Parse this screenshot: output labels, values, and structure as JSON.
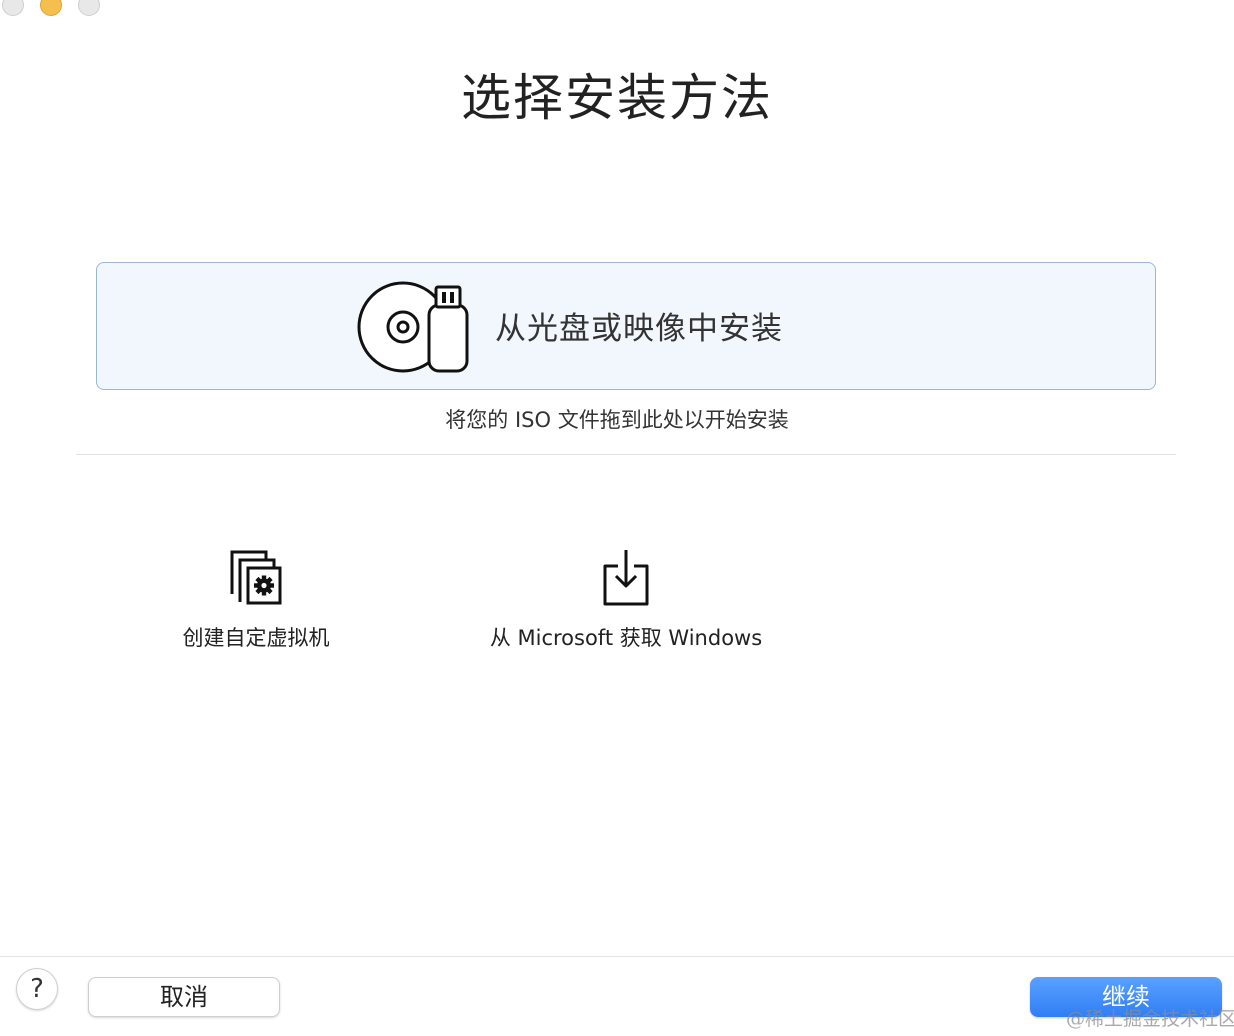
{
  "window": {
    "controls": [
      "close-button",
      "minimize-button",
      "zoom-button"
    ]
  },
  "header": {
    "title": "选择安装方法"
  },
  "primary_option": {
    "label": "从光盘或映像中安装",
    "icon": "disc-usb-icon",
    "hint": "将您的 ISO 文件拖到此处以开始安装"
  },
  "secondary_options": [
    {
      "label": "创建自定虚拟机",
      "icon": "custom-vm-gear-icon"
    },
    {
      "label": "从 Microsoft 获取 Windows",
      "icon": "download-tray-icon"
    }
  ],
  "footer": {
    "help_label": "?",
    "cancel_label": "取消",
    "continue_label": "继续"
  },
  "watermark": "@稀土掘金技术社区",
  "colors": {
    "accent": "#2f7ef5",
    "selected_card_bg": "#f2f7fd",
    "selected_card_border": "#9eb6d4",
    "minimize_light": "#f5bf4f"
  }
}
